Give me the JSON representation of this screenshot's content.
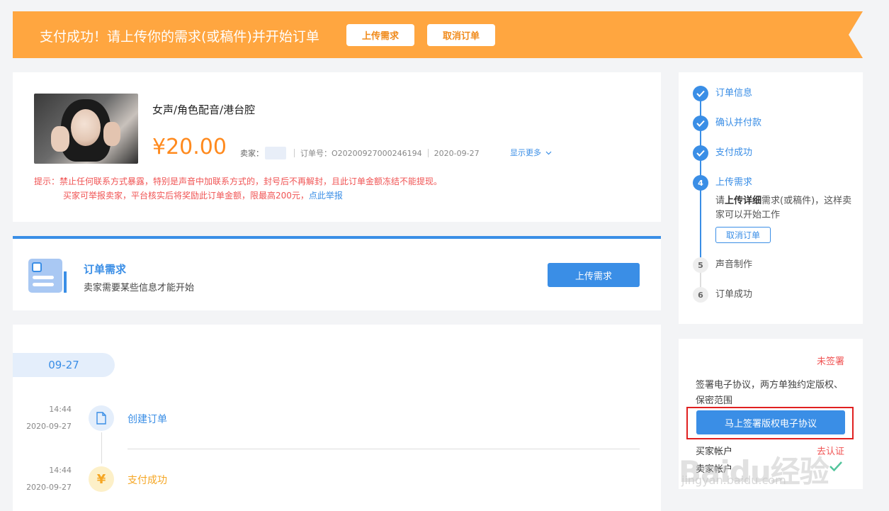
{
  "banner": {
    "title": "支付成功！请上传你的需求(或稿件)并开始订单",
    "upload_label": "上传需求",
    "cancel_label": "取消订单"
  },
  "order": {
    "title": "女声/角色配音/港台腔",
    "price": "¥20.00",
    "seller_label": "卖家：",
    "order_no": "订单号：O20200927000246194",
    "date": "2020-09-27",
    "show_more": "显示更多",
    "tip_line1": "提示：禁止任何联系方式暴露，特别是声音中加联系方式的，封号后不再解封，且此订单金额冻结不能提现。",
    "tip_line2": "买家可举报卖家，平台核实后将奖励此订单金额，限最高200元，",
    "tip_report": "点此举报"
  },
  "requirement": {
    "title": "订单需求",
    "subtitle": "卖家需要某些信息才能开始",
    "button": "上传需求"
  },
  "timeline": {
    "date_pill": "09-27",
    "events": [
      {
        "time": "14:44",
        "date": "2020-09-27",
        "label": "创建订单",
        "icon": "document-icon",
        "color": "#3a8ee6"
      },
      {
        "time": "14:44",
        "date": "2020-09-27",
        "label": "支付成功",
        "icon": "yen-icon",
        "color": "#f5a623"
      }
    ]
  },
  "steps": {
    "items": [
      {
        "number": "1",
        "label": "订单信息",
        "state": "done"
      },
      {
        "number": "2",
        "label": "确认并付款",
        "state": "done"
      },
      {
        "number": "3",
        "label": "支付成功",
        "state": "done"
      },
      {
        "number": "4",
        "label": "上传需求",
        "state": "active"
      },
      {
        "number": "5",
        "label": "声音制作",
        "state": "todo"
      },
      {
        "number": "6",
        "label": "订单成功",
        "state": "todo"
      }
    ],
    "active_desc_pre": "请",
    "active_desc_bold": "上传详细",
    "active_desc_post": "需求(或稿件)，这样卖家可以开始工作",
    "cancel_label": "取消订单"
  },
  "agreement": {
    "status": "未签署",
    "text": "签署电子协议，两方单独约定版权、保密范围",
    "sign_button": "马上签署版权电子协议",
    "account1_label": "买家帐户",
    "verify_label": "去认证",
    "account2_label": "卖家帐户"
  },
  "watermark": {
    "text": "Baidu经验",
    "url": "jingyan.baidu.com"
  },
  "colors": {
    "accent": "#3a8ee6",
    "banner": "#ffa640",
    "price": "#ff8a1e",
    "warning": "#f05454",
    "success": "#52c49b"
  }
}
